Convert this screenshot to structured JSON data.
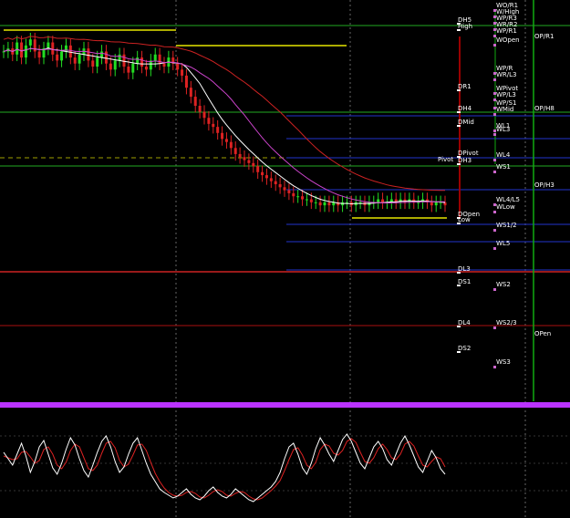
{
  "chart_data": {
    "type": "line",
    "panels": [
      "price",
      "stochastic"
    ],
    "colors": {
      "background": "#000000",
      "bull_candle": "#22dd22",
      "bear_candle": "#dd2222",
      "ma_fast": "#ffffff",
      "ma_slow": "#cc44cc",
      "ma_slower": "#cc2222",
      "daily_level": "#22aa22",
      "weekly_level": "#2233cc",
      "range_box": "#e6e600",
      "separator": "#bb33ff",
      "stoch_k": "#ffffff",
      "stoch_d": "#dd2222",
      "vgrid": "#666666"
    },
    "vgrid_count": 3,
    "level_labels": {
      "daily": [
        "DH5",
        "High",
        "DR1",
        "DH4",
        "DMid",
        "DPivot",
        "DH3",
        "DOpen",
        "Low",
        "DL3",
        "DS1",
        "DL4",
        "DS2"
      ],
      "weekly": [
        "WO/R1",
        "W/High",
        "WP/R3",
        "WR/R2",
        "WP/R1",
        "WOpen",
        "WP/R",
        "WR/L3",
        "WPivot",
        "WP/L3",
        "WP/S1",
        "WMid",
        "WL1",
        "WL3",
        "WL4",
        "WS1",
        "WL4/L5",
        "WLow",
        "WS1/2",
        "WL5",
        "WS2",
        "WS2/3",
        "WS3"
      ],
      "other": [
        "OP/R1",
        "OP/H8",
        "OP/H3",
        "OPen",
        "Pivot"
      ]
    },
    "price_series": {
      "close": [
        62,
        63,
        61,
        65,
        60,
        64,
        66,
        62,
        60,
        63,
        65,
        61,
        59,
        62,
        64,
        60,
        58,
        61,
        63,
        59,
        57,
        60,
        62,
        58,
        56,
        59,
        61,
        57,
        55,
        58,
        60,
        57,
        56,
        59,
        61,
        58,
        57,
        60,
        58,
        56,
        54,
        50,
        47,
        44,
        42,
        40,
        38,
        37,
        35,
        33,
        32,
        30,
        28,
        27,
        26,
        25,
        24,
        22,
        21,
        20,
        19,
        18,
        17,
        16,
        15,
        14,
        14,
        13,
        13,
        12,
        12,
        11,
        12,
        11,
        12,
        11,
        12,
        12,
        11,
        12,
        12,
        11,
        12,
        12,
        13,
        12,
        12,
        13,
        12,
        13,
        12,
        13,
        12,
        12,
        13,
        12,
        11,
        12,
        12,
        11
      ]
    },
    "stochastic": {
      "k": [
        62,
        55,
        48,
        60,
        72,
        58,
        40,
        52,
        68,
        75,
        60,
        45,
        38,
        50,
        65,
        78,
        70,
        55,
        42,
        35,
        48,
        62,
        74,
        80,
        68,
        52,
        40,
        46,
        60,
        72,
        78,
        64,
        50,
        38,
        30,
        22,
        18,
        15,
        12,
        14,
        18,
        22,
        16,
        12,
        10,
        14,
        20,
        24,
        18,
        14,
        12,
        16,
        22,
        18,
        14,
        10,
        8,
        12,
        16,
        20,
        24,
        30,
        40,
        55,
        68,
        72,
        60,
        45,
        38,
        50,
        66,
        78,
        70,
        60,
        52,
        64,
        76,
        82,
        74,
        62,
        50,
        44,
        56,
        68,
        74,
        66,
        54,
        48,
        60,
        72,
        80,
        70,
        58,
        46,
        40,
        52,
        64,
        56,
        44,
        38
      ],
      "d": [
        58,
        56,
        54,
        55,
        62,
        63,
        57,
        50,
        53,
        65,
        68,
        60,
        48,
        44,
        51,
        64,
        71,
        68,
        56,
        44,
        42,
        48,
        61,
        72,
        74,
        67,
        53,
        46,
        49,
        59,
        70,
        71,
        64,
        51,
        39,
        30,
        23,
        18,
        15,
        14,
        15,
        18,
        19,
        17,
        13,
        12,
        15,
        19,
        21,
        19,
        15,
        14,
        17,
        19,
        18,
        14,
        11,
        10,
        12,
        16,
        20,
        25,
        31,
        42,
        54,
        65,
        67,
        59,
        48,
        44,
        51,
        65,
        71,
        69,
        61,
        59,
        64,
        74,
        77,
        73,
        62,
        52,
        50,
        56,
        66,
        71,
        65,
        56,
        54,
        60,
        71,
        74,
        69,
        58,
        48,
        46,
        52,
        57,
        55,
        46
      ]
    }
  }
}
